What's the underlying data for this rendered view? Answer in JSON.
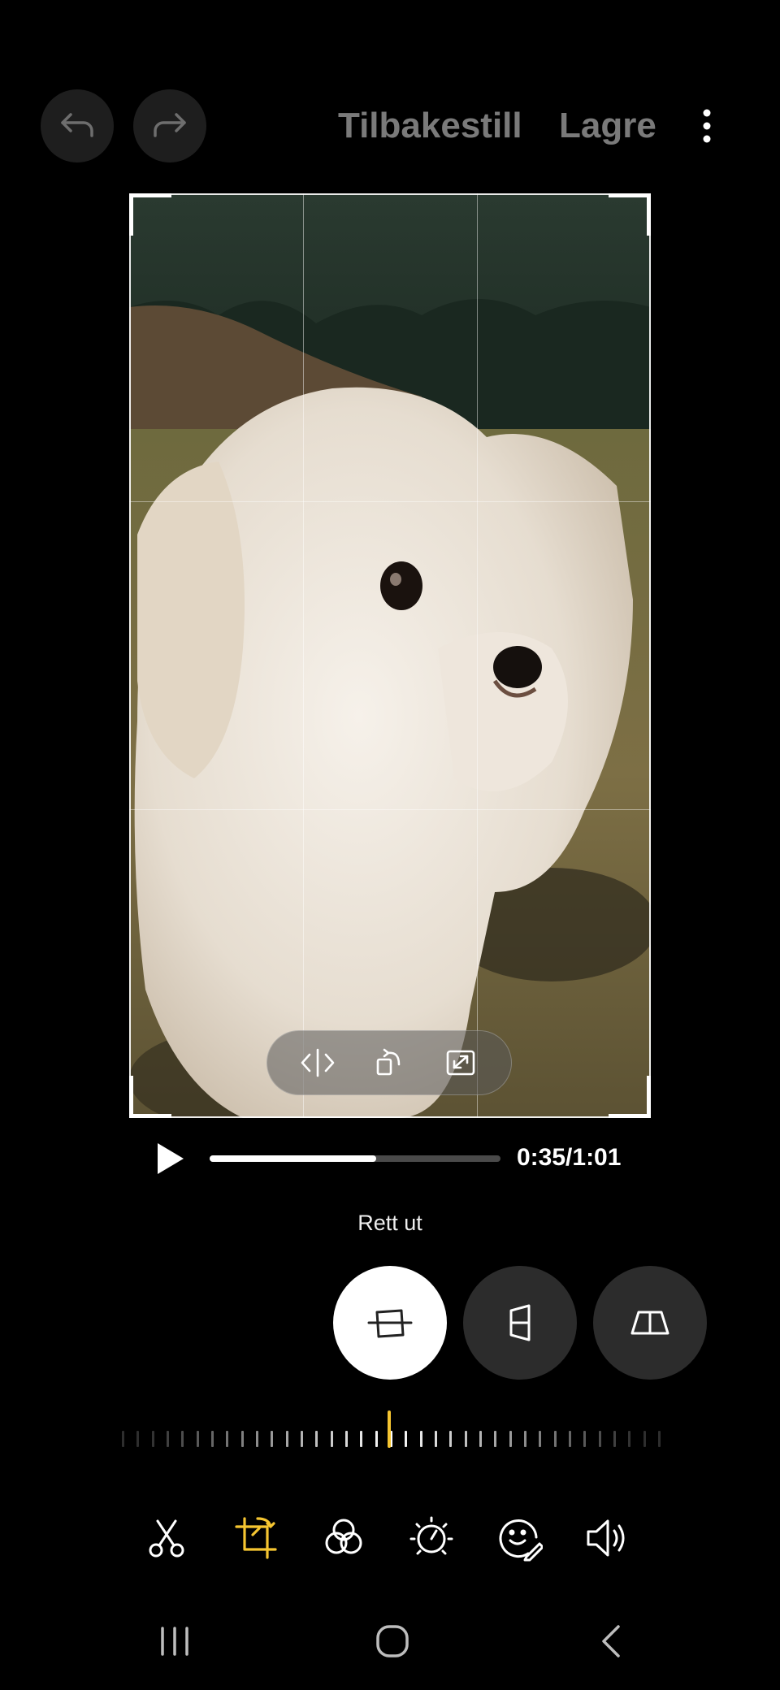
{
  "header": {
    "undo_icon": "undo-icon",
    "redo_icon": "redo-icon",
    "reset_label": "Tilbakestill",
    "save_label": "Lagre",
    "more_icon": "more-vertical-icon"
  },
  "crop_overlay": {
    "tools": [
      "flip-horizontal-icon",
      "rotate-icon",
      "expand-icon"
    ]
  },
  "playback": {
    "play_icon": "play-icon",
    "time": "0:35/1:01",
    "progress": 0.574
  },
  "transform": {
    "label": "Rett ut",
    "modes": [
      "straighten-icon",
      "vertical-perspective-icon",
      "horizontal-perspective-icon"
    ],
    "active_mode": 0
  },
  "toolbar": {
    "items": [
      "trim-icon",
      "crop-rotate-icon",
      "filter-icon",
      "brightness-icon",
      "sticker-icon",
      "volume-icon"
    ],
    "active_index": 1,
    "accent_color": "#f5c531"
  },
  "navbar": {
    "items": [
      "recent-apps-icon",
      "home-icon",
      "back-icon"
    ]
  }
}
